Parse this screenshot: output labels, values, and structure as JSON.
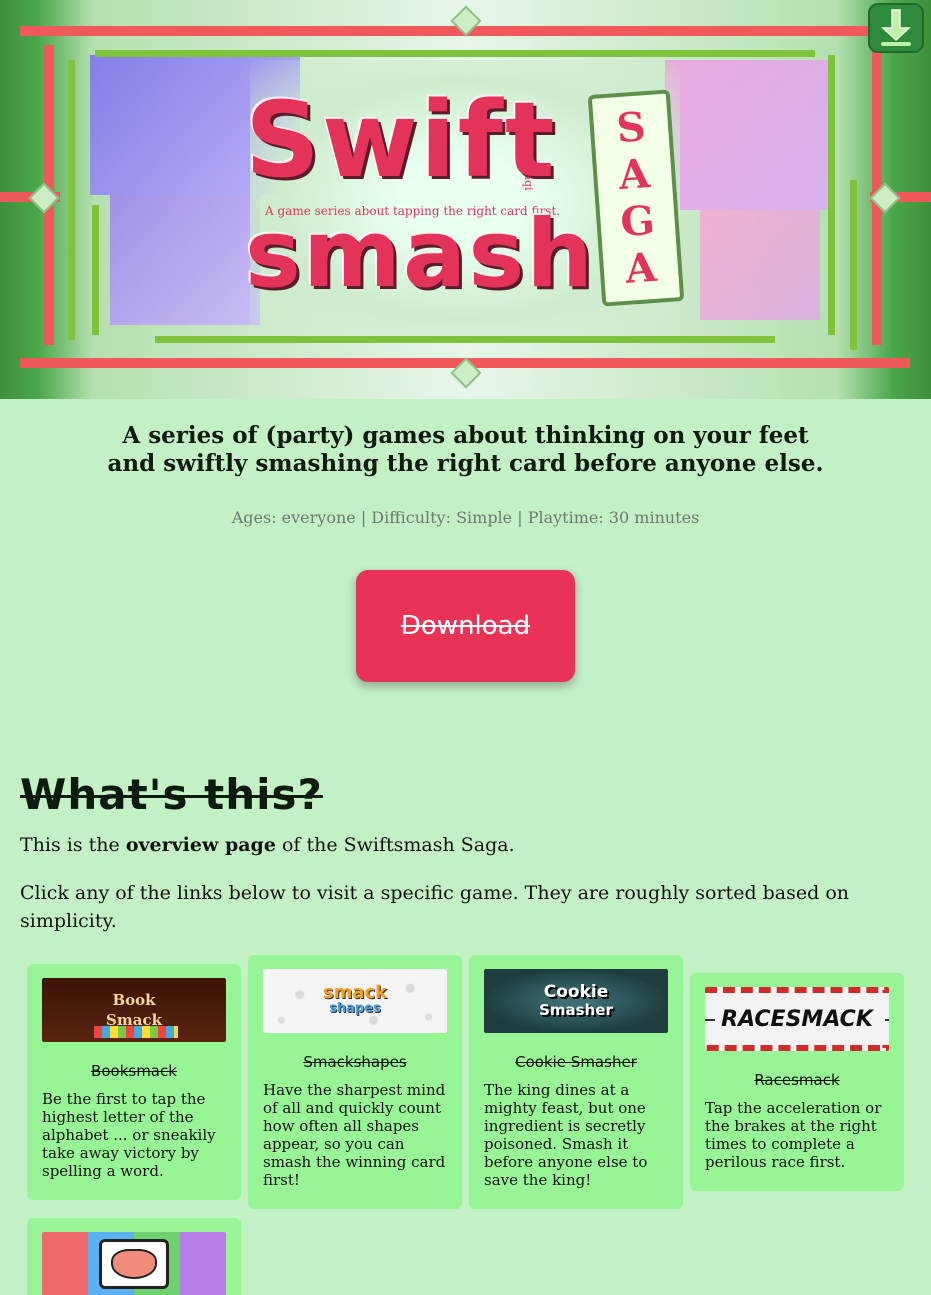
{
  "banner": {
    "title_line1": "Swift",
    "title_line2": "smash",
    "saga_letters": [
      "S",
      "A",
      "G",
      "A"
    ],
    "subtitle": "A game series about tapping the right card first.",
    "byline": "By Pandaqi",
    "download_icon": "download-arrow-icon"
  },
  "intro": {
    "tagline_line1": "A series of (party) games about thinking on your feet",
    "tagline_line2": "and swiftly smashing the right card before anyone else.",
    "meta": "Ages: everyone | Difficulty: Simple | Playtime: 30 minutes",
    "download_label": "Download"
  },
  "about": {
    "title": "What's this?",
    "p1_before": "This is the ",
    "p1_bold": "overview page",
    "p1_after": " of the Swiftsmash Saga.",
    "p2": "Click any of the links below to visit a specific game. They are roughly sorted based on simplicity."
  },
  "games": [
    {
      "name": "Booksmack",
      "thumb_line1": "Book",
      "thumb_line2": "Smack",
      "description": "Be the first to tap the highest letter of the alphabet ... or sneakily take away victory by spelling a word."
    },
    {
      "name": "Smackshapes",
      "thumb_line1": "smack",
      "thumb_line2": "shapes",
      "description": "Have the sharpest mind of all and quickly count how often all shapes appear, so you can smash the winning card first!"
    },
    {
      "name": "Cookie Smasher",
      "thumb_line1": "Cookie",
      "thumb_line2": "Smasher",
      "description": "The king dines at a mighty feast, but one ingredient is secretly poisoned. Smash it before anyone else to save the king!"
    },
    {
      "name": "Racesmack",
      "thumb_line1": "RACESMACK",
      "thumb_line2": "",
      "description": "Tap the acceleration or the brakes at the right times to complete a perilous race first."
    },
    {
      "name": "",
      "thumb_line1": "",
      "thumb_line2": "",
      "description": ""
    }
  ],
  "colors": {
    "background": "#c4f0c6",
    "card": "#98f595",
    "accent": "#e83356",
    "title_pink": "#e4335a"
  }
}
